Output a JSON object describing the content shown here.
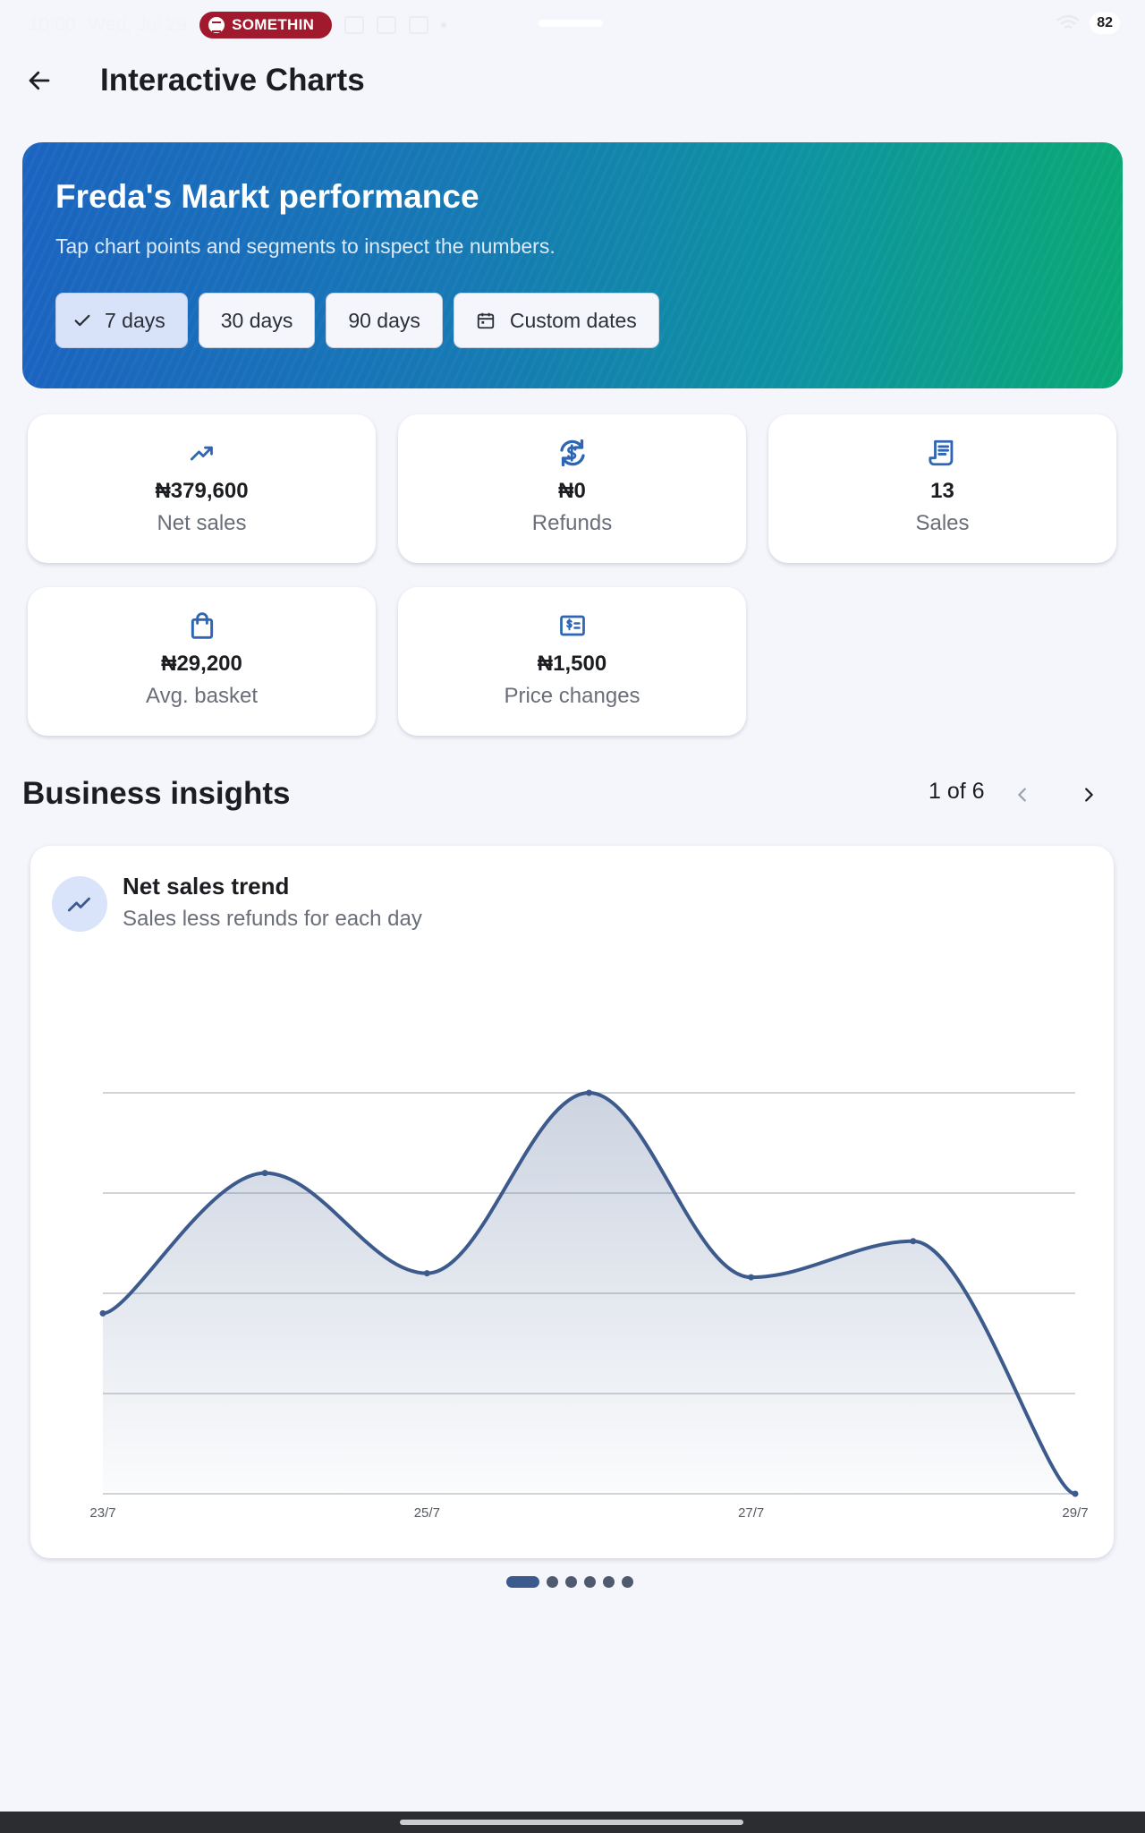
{
  "status_bar": {
    "time": "10:00",
    "date": "Wed, Jul 29",
    "media_pill": "SOMETHIN",
    "battery": "82"
  },
  "app_bar": {
    "title": "Interactive Charts",
    "back_icon": "arrow-left-icon"
  },
  "hero": {
    "title": "Freda's Markt performance",
    "subtitle": "Tap chart points and segments to inspect the numbers.",
    "chips": [
      {
        "label": "7 days",
        "selected": true,
        "icon": "check-icon"
      },
      {
        "label": "30 days",
        "selected": false
      },
      {
        "label": "90 days",
        "selected": false
      },
      {
        "label": "Custom dates",
        "selected": false,
        "icon": "calendar-icon"
      }
    ],
    "gradient_colors": [
      "#1b64c0",
      "#0aa874"
    ]
  },
  "stats": [
    {
      "icon": "trending-up-icon",
      "value": "₦379,600",
      "label": "Net sales"
    },
    {
      "icon": "currency-exchange-icon",
      "value": "₦0",
      "label": "Refunds"
    },
    {
      "icon": "receipt-icon",
      "value": "13",
      "label": "Sales"
    },
    {
      "icon": "shopping-bag-icon",
      "value": "₦29,200",
      "label": "Avg. basket"
    },
    {
      "icon": "price-tag-icon",
      "value": "₦1,500",
      "label": "Price changes"
    }
  ],
  "insights": {
    "section_title": "Business insights",
    "pager_text": "1 of 6",
    "card": {
      "icon": "trending-up-icon",
      "title": "Net sales trend",
      "subtitle": "Sales less refunds for each day"
    },
    "page_count": 6,
    "active_page": 1
  },
  "chart_data": {
    "type": "area",
    "title": "Net sales trend",
    "x": [
      "23/7",
      "24/7",
      "25/7",
      "26/7",
      "27/7",
      "28/7",
      "29/7"
    ],
    "tick_labels": [
      "23/7",
      "25/7",
      "27/7",
      "29/7"
    ],
    "values": [
      0.45,
      0.8,
      0.55,
      1.0,
      0.54,
      0.63,
      0.0
    ],
    "grid": true,
    "color": "#3d5a8c"
  },
  "colors": {
    "accent": "#3d5a8c",
    "icon_blue": "#2f66b3",
    "background": "#f4f6fb"
  }
}
